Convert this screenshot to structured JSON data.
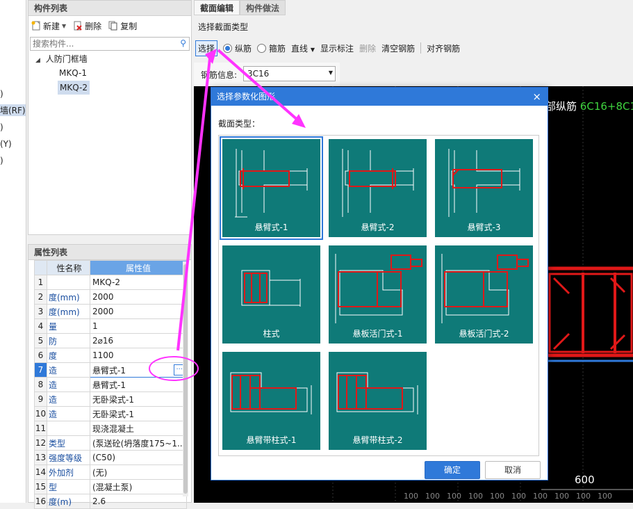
{
  "left_strip": {
    "items": [
      ")",
      "墙(RF)",
      ")",
      "(Y)",
      ")"
    ]
  },
  "component_list": {
    "title": "构件列表",
    "toolbar": {
      "new": "新建",
      "delete": "删除",
      "copy": "复制"
    },
    "search": {
      "placeholder": "搜索构件..."
    },
    "tree": {
      "root": "人防门框墙",
      "children": [
        "MKQ-1",
        "MKQ-2"
      ]
    }
  },
  "property_list": {
    "title": "属性列表",
    "headers": {
      "name": "性名称",
      "value": "属性值"
    },
    "rows": [
      {
        "n": "1",
        "name": "",
        "value": "MKQ-2"
      },
      {
        "n": "2",
        "name": "度(mm)",
        "value": "2000"
      },
      {
        "n": "3",
        "name": "度(mm)",
        "value": "2000"
      },
      {
        "n": "4",
        "name": "量",
        "value": "1"
      },
      {
        "n": "5",
        "name": "防",
        "value": "2⌀16"
      },
      {
        "n": "6",
        "name": "度",
        "value": "1100"
      },
      {
        "n": "7",
        "name": "造",
        "value": "悬臂式-1"
      },
      {
        "n": "8",
        "name": "造",
        "value": "悬臂式-1"
      },
      {
        "n": "9",
        "name": "造",
        "value": "无卧梁式-1"
      },
      {
        "n": "10",
        "name": "造",
        "value": "无卧梁式-1"
      },
      {
        "n": "11",
        "name": "",
        "value": "现浇混凝土"
      },
      {
        "n": "12",
        "name": "类型",
        "value": "(泵送砼(坍落度175~1..."
      },
      {
        "n": "13",
        "name": "强度等级",
        "value": "(C50)"
      },
      {
        "n": "14",
        "name": "外加剂",
        "value": "(无)"
      },
      {
        "n": "15",
        "name": "型",
        "value": "(混凝土泵)"
      },
      {
        "n": "16",
        "name": "度(m)",
        "value": "2.6"
      }
    ],
    "ellipsis": "···"
  },
  "right": {
    "tabs": [
      "截面编辑",
      "构件做法"
    ],
    "section_label": "选择截面类型",
    "toolbar": {
      "select": "选择",
      "longitudinal": "纵筋",
      "stirrup": "箍筋",
      "line": "直线",
      "show_annotation": "显示标注",
      "delete": "删除",
      "clear_rebar": "清空钢筋",
      "align_rebar": "对齐钢筋"
    },
    "rebar_info_label": "钢筋信息:",
    "rebar_info_value": "3C16",
    "canvas": {
      "label_white": "部纵筋",
      "label_green": "6C16+8C1",
      "dim_600": "600",
      "ticks": [
        "100",
        "100",
        "100",
        "100",
        "100",
        "100",
        "100",
        "100",
        "100",
        "100"
      ]
    }
  },
  "dialog": {
    "title": "选择参数化图形",
    "section_type_label": "截面类型：",
    "tiles": [
      "悬臂式-1",
      "悬臂式-2",
      "悬臂式-3",
      "柱式",
      "悬板活门式-1",
      "悬板活门式-2",
      "悬臂带柱式-1",
      "悬臂带柱式-2"
    ],
    "ok": "确定",
    "cancel": "取消"
  },
  "colors": {
    "teal": "#0f7a78",
    "accent": "#2f79d9",
    "annotation": "#ff33ff",
    "rebar": "#e01818"
  }
}
